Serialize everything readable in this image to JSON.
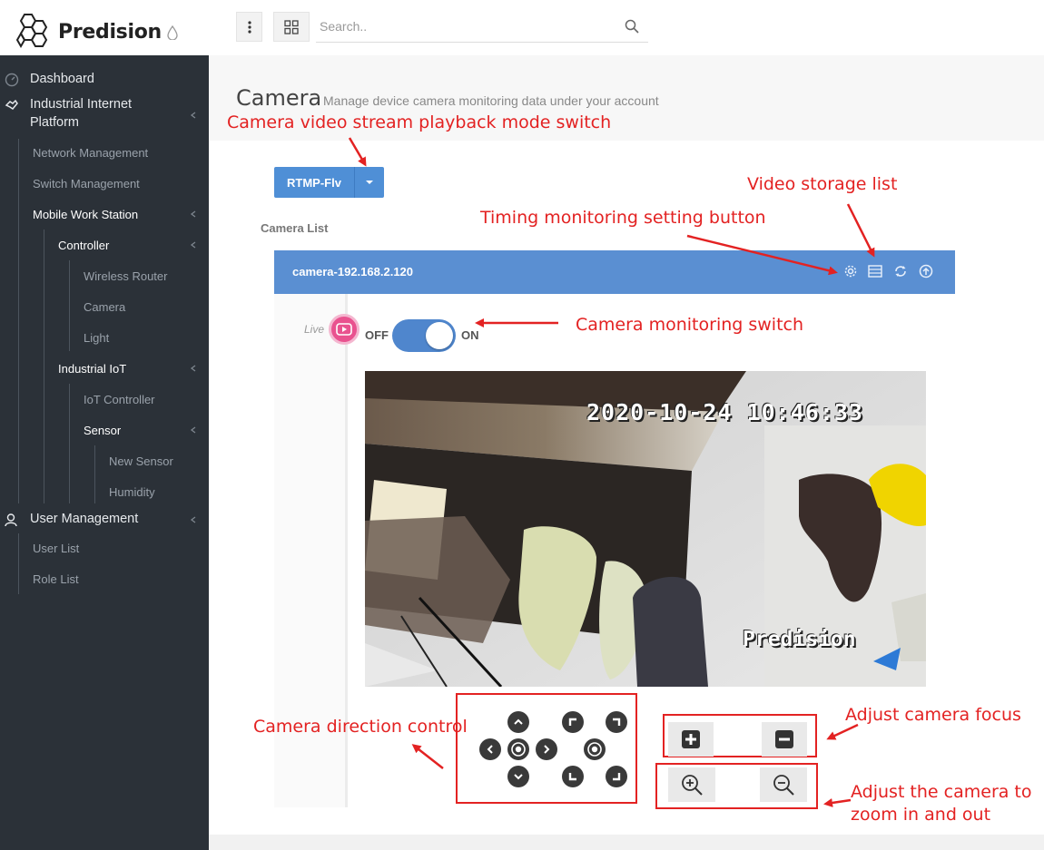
{
  "brand": {
    "name": "Predision"
  },
  "search": {
    "placeholder": "Search.."
  },
  "sidebar": {
    "dashboard": "Dashboard",
    "industrial_platform": [
      "Industrial Internet",
      "Platform"
    ],
    "network_management": "Network Management",
    "switch_management": "Switch Management",
    "mobile_work_station": "Mobile Work Station",
    "controller": "Controller",
    "wireless_router": "Wireless Router",
    "camera": "Camera",
    "light": "Light",
    "industrial_iot": "Industrial IoT",
    "iot_controller": "IoT Controller",
    "sensor": "Sensor",
    "new_sensor": "New Sensor",
    "humidity": "Humidity",
    "user_management": "User Management",
    "user_list": "User List",
    "role_list": "Role List"
  },
  "page": {
    "title": "Camera",
    "subtitle": "Manage device camera monitoring data under your account",
    "mode_label": "RTMP-Flv",
    "camera_list_label": "Camera List"
  },
  "camera": {
    "name": "camera-192.168.2.120",
    "live_label": "Live",
    "switch_off": "OFF",
    "switch_on": "ON",
    "switch_state": "on",
    "timestamp": "2020-10-24  10:46:33",
    "watermark": "Predision"
  },
  "annotations": {
    "playback_mode": "Camera video stream playback mode switch",
    "video_storage": "Video storage list",
    "timing_monitoring": "Timing monitoring setting button",
    "monitoring_switch": "Camera monitoring switch",
    "direction_control": "Camera direction control",
    "focus": "Adjust camera focus",
    "zoom_line1": "Adjust the camera to",
    "zoom_line2": "zoom in and out"
  },
  "colors": {
    "sidebar_bg": "#2b3138",
    "accent_blue": "#4f8fd6",
    "annotation_red": "#e32222",
    "live_pink": "#e9528f"
  },
  "icons": {
    "header_actions": [
      "gear-icon",
      "list-icon",
      "refresh-icon",
      "upload-icon"
    ],
    "direction": [
      "up-icon",
      "down-icon",
      "left-icon",
      "right-icon",
      "center-icon",
      "top-left-icon",
      "top-right-icon",
      "bottom-left-icon",
      "bottom-right-icon",
      "center-icon"
    ],
    "focus": [
      "plus-icon",
      "minus-icon"
    ],
    "zoom": [
      "zoom-in-icon",
      "zoom-out-icon"
    ]
  }
}
